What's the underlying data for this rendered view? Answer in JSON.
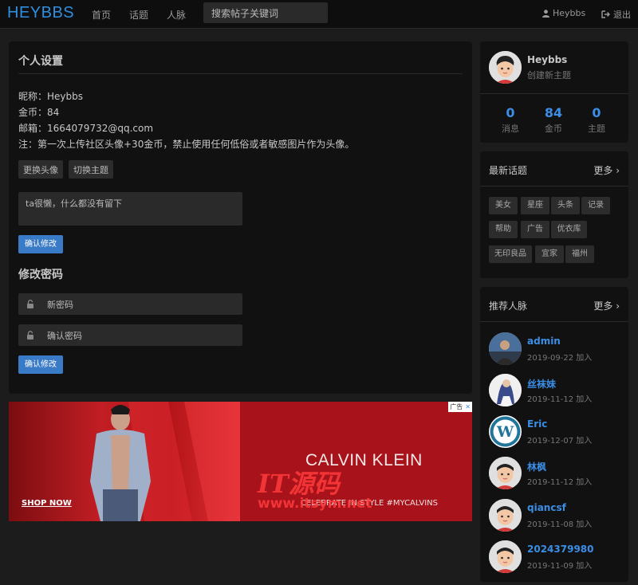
{
  "nav": {
    "brand": "HEYBBS",
    "links": [
      "首页",
      "话题",
      "人脉"
    ],
    "search_placeholder": "搜索帖子关键词",
    "user": "Heybbs",
    "logout": "退出"
  },
  "settings": {
    "title": "个人设置",
    "nickname": "昵称：Heybbs",
    "coins": "金币：84",
    "email": "邮箱：1664079732@qq.com",
    "note": "注：第一次上传社区头像+30金币，禁止使用任何低俗或者敏感图片作为头像。",
    "change_avatar": "更换头像",
    "change_theme": "切换主题",
    "bio_placeholder": "ta很懒，什么都没有留下",
    "confirm1": "确认修改",
    "pwd_title": "修改密码",
    "new_pwd": "新密码",
    "confirm_pwd": "确认密码",
    "confirm2": "确认修改"
  },
  "ad": {
    "badge": "广告",
    "brand": "CALVIN KLEIN",
    "tagline": "CELEBRATE IN STYLE #MYCALVINS",
    "shop": "SHOP NOW"
  },
  "watermark": {
    "logo": "IT源码",
    "url": "www.itsym.net"
  },
  "profile": {
    "name": "Heybbs",
    "create_link": "创建新主题",
    "stats": [
      {
        "value": "0",
        "label": "消息"
      },
      {
        "value": "84",
        "label": "金币"
      },
      {
        "value": "0",
        "label": "主题"
      }
    ]
  },
  "topics": {
    "title": "最新话题",
    "more": "更多",
    "tags": [
      "美女",
      "星座",
      "头条",
      "记录",
      "帮助",
      "广告",
      "优衣库",
      "无印良品",
      "宜家",
      "福州"
    ]
  },
  "people": {
    "title": "推荐人脉",
    "more": "更多",
    "list": [
      {
        "name": "admin",
        "date": "2019-09-22 加入"
      },
      {
        "name": "丝袜妹",
        "date": "2019-11-12 加入"
      },
      {
        "name": "Eric",
        "date": "2019-12-07 加入"
      },
      {
        "name": "林枫",
        "date": "2019-11-12 加入"
      },
      {
        "name": "qiancsf",
        "date": "2019-11-08 加入"
      },
      {
        "name": "2024379980",
        "date": "2019-11-09 加入"
      }
    ]
  },
  "colors": {
    "accent": "#3a8ee6",
    "button": "#3a7bc8",
    "panel": "#111111",
    "background": "#1c1c1c"
  }
}
